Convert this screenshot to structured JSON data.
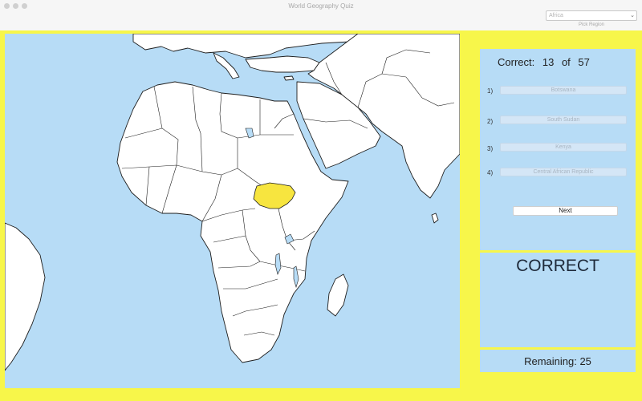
{
  "window": {
    "title": "World Geography Quiz"
  },
  "region": {
    "selected": "Africa",
    "label": "Pick Region"
  },
  "quiz": {
    "correct_label": "Correct:",
    "correct_count": "13",
    "of_label": "of",
    "total": "57",
    "options": [
      {
        "number": "1)",
        "label": "Botswana"
      },
      {
        "number": "2)",
        "label": "South Sudan"
      },
      {
        "number": "3)",
        "label": "Kenya"
      },
      {
        "number": "4)",
        "label": "Central African Republic"
      }
    ],
    "next_label": "Next"
  },
  "result": {
    "text": "CORRECT"
  },
  "remaining": {
    "text": "Remaining: 25"
  },
  "map": {
    "highlighted_country": "South Sudan",
    "highlight_color": "#f7e53f",
    "ocean_color": "#b7dcf6",
    "land_color": "#ffffff"
  },
  "colors": {
    "background": "#f7f64a",
    "panel": "#b7dcf6",
    "button": "#d4e6f6"
  },
  "icons": {
    "dropdown": "chevron-updown-icon"
  }
}
